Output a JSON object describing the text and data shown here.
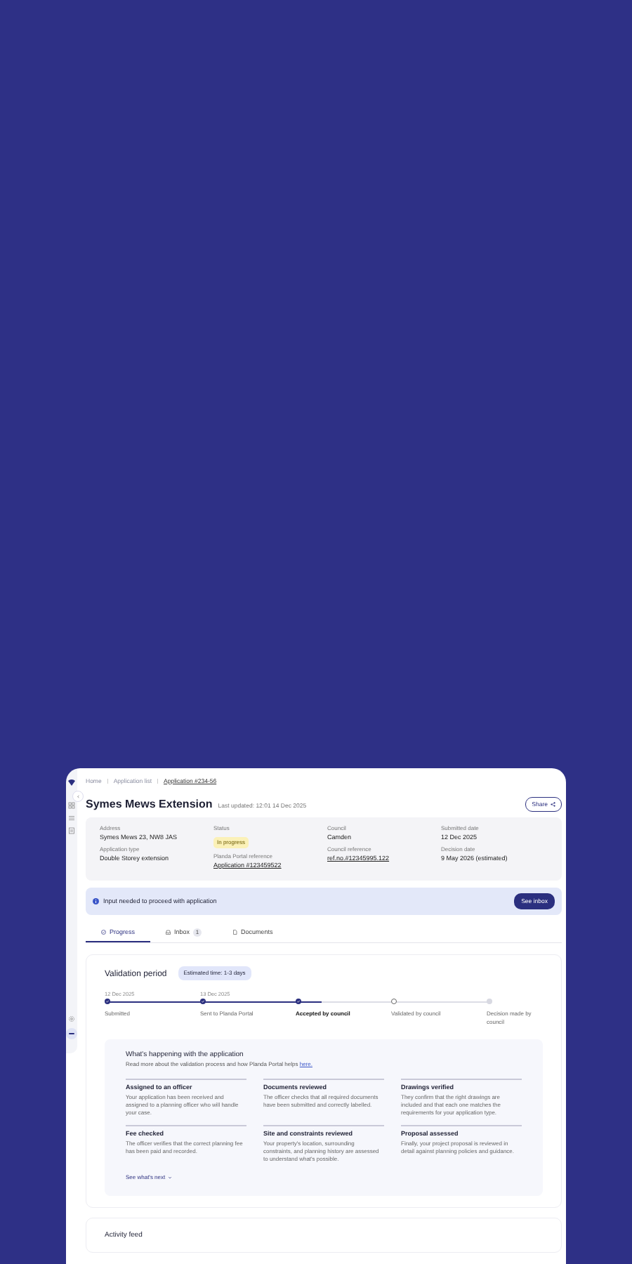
{
  "breadcrumb": [
    {
      "label": "Home",
      "current": false
    },
    {
      "label": "Application list",
      "current": false
    },
    {
      "label": "Application #234-56",
      "current": true
    }
  ],
  "header": {
    "title": "Symes Mews Extension",
    "updated": "Last updated: 12:01 14 Dec 2025",
    "share_button": "Share"
  },
  "details": [
    {
      "fields": [
        {
          "label": "Address",
          "value": "Symes Mews 23, NW8 JAS",
          "kind": "text"
        },
        {
          "label": "Application type",
          "value": "Double Storey extension",
          "kind": "text"
        }
      ]
    },
    {
      "fields": [
        {
          "label": "Status",
          "value": "In progress",
          "kind": "badge"
        },
        {
          "label": "Planda Portal reference",
          "value": "Application #123459522",
          "kind": "link"
        }
      ]
    },
    {
      "fields": [
        {
          "label": "Council",
          "value": "Camden",
          "kind": "text"
        },
        {
          "label": "Council reference",
          "value": "ref.no.#12345995.122",
          "kind": "link"
        }
      ]
    },
    {
      "fields": [
        {
          "label": "Submitted date",
          "value": "12 Dec 2025",
          "kind": "text"
        },
        {
          "label": "Decision date",
          "value": "9 May 2026 (estimated)",
          "kind": "text"
        }
      ]
    }
  ],
  "alert": {
    "message": "Input needed to proceed with application",
    "button": "See inbox"
  },
  "tabs": [
    {
      "label": "Progress",
      "selected": true
    },
    {
      "label": "Inbox",
      "count": "1",
      "selected": false
    },
    {
      "label": "Documents",
      "selected": false
    }
  ],
  "validation": {
    "title": "Validation period",
    "estimate": "Estimated time: 1-3 days",
    "level": 0.56,
    "steps": [
      {
        "label": "Submitted",
        "date": "12 Dec 2025",
        "kind": "done"
      },
      {
        "label": "Sent to Planda Portal",
        "date": "13 Dec 2025",
        "kind": "done"
      },
      {
        "label": "Accepted by council",
        "kind": "current"
      },
      {
        "label": "Validated by council",
        "kind": "next"
      },
      {
        "label": "Decision made by council",
        "kind": "pending"
      }
    ]
  },
  "info": {
    "title": "What's happening with the application",
    "intro": "Read more about the validation process and how Planda Portal helps ",
    "link": "here.",
    "items": [
      {
        "title": "Assigned to an officer",
        "text": "Your application has been received and assigned to a planning officer who will handle your case."
      },
      {
        "title": "Documents reviewed",
        "text": "The officer checks that all required documents have been submitted and correctly labelled."
      },
      {
        "title": "Drawings verified",
        "text": "They confirm that the right drawings are included and that each one matches the requirements for your application type."
      },
      {
        "title": "Fee checked",
        "text": "The officer verifies that the correct planning fee has been paid and recorded."
      },
      {
        "title": "Site and constraints reviewed",
        "text": "Your property's location, surrounding constraints, and planning history are assessed to understand what's possible."
      },
      {
        "title": "Proposal assessed",
        "text": "Finally, your project proposal is reviewed in detail against planning policies and guidance."
      }
    ],
    "more": "See what's next"
  },
  "activity": {
    "title": "Activity feed"
  }
}
